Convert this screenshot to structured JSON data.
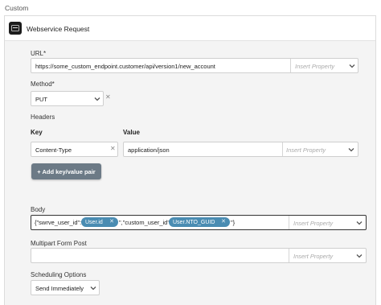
{
  "section": {
    "title": "Custom"
  },
  "header": {
    "title": "Webservice Request",
    "icon": "webservice-icon"
  },
  "url": {
    "label": "URL*",
    "value": "https://some_custom_endpoint.customer/api/version1/new_account",
    "insert_placeholder": "Insert Property"
  },
  "method": {
    "label": "Method*",
    "value": "PUT"
  },
  "headers": {
    "label": "Headers",
    "key_label": "Key",
    "value_label": "Value",
    "rows": [
      {
        "key": "Content-Type",
        "value": "application/json",
        "insert_placeholder": "Insert Property"
      }
    ],
    "add_button": "+ Add key/value pair"
  },
  "body": {
    "label": "Body",
    "text_1": "{\"swrve_user_id\":\"",
    "pill_1": "User.id",
    "text_2": "\",\"custom_user_id\":\"",
    "pill_2": "User.NTO_GUID",
    "text_3": "\"}",
    "insert_placeholder": "Insert Property"
  },
  "multipart": {
    "label": "Multipart Form Post",
    "value": "",
    "insert_placeholder": "Insert Property"
  },
  "scheduling": {
    "label": "Scheduling Options",
    "value": "Send Immediately"
  },
  "colors": {
    "pill": "#4a8cb2",
    "button": "#6c7a86",
    "body_border": "#333333"
  }
}
